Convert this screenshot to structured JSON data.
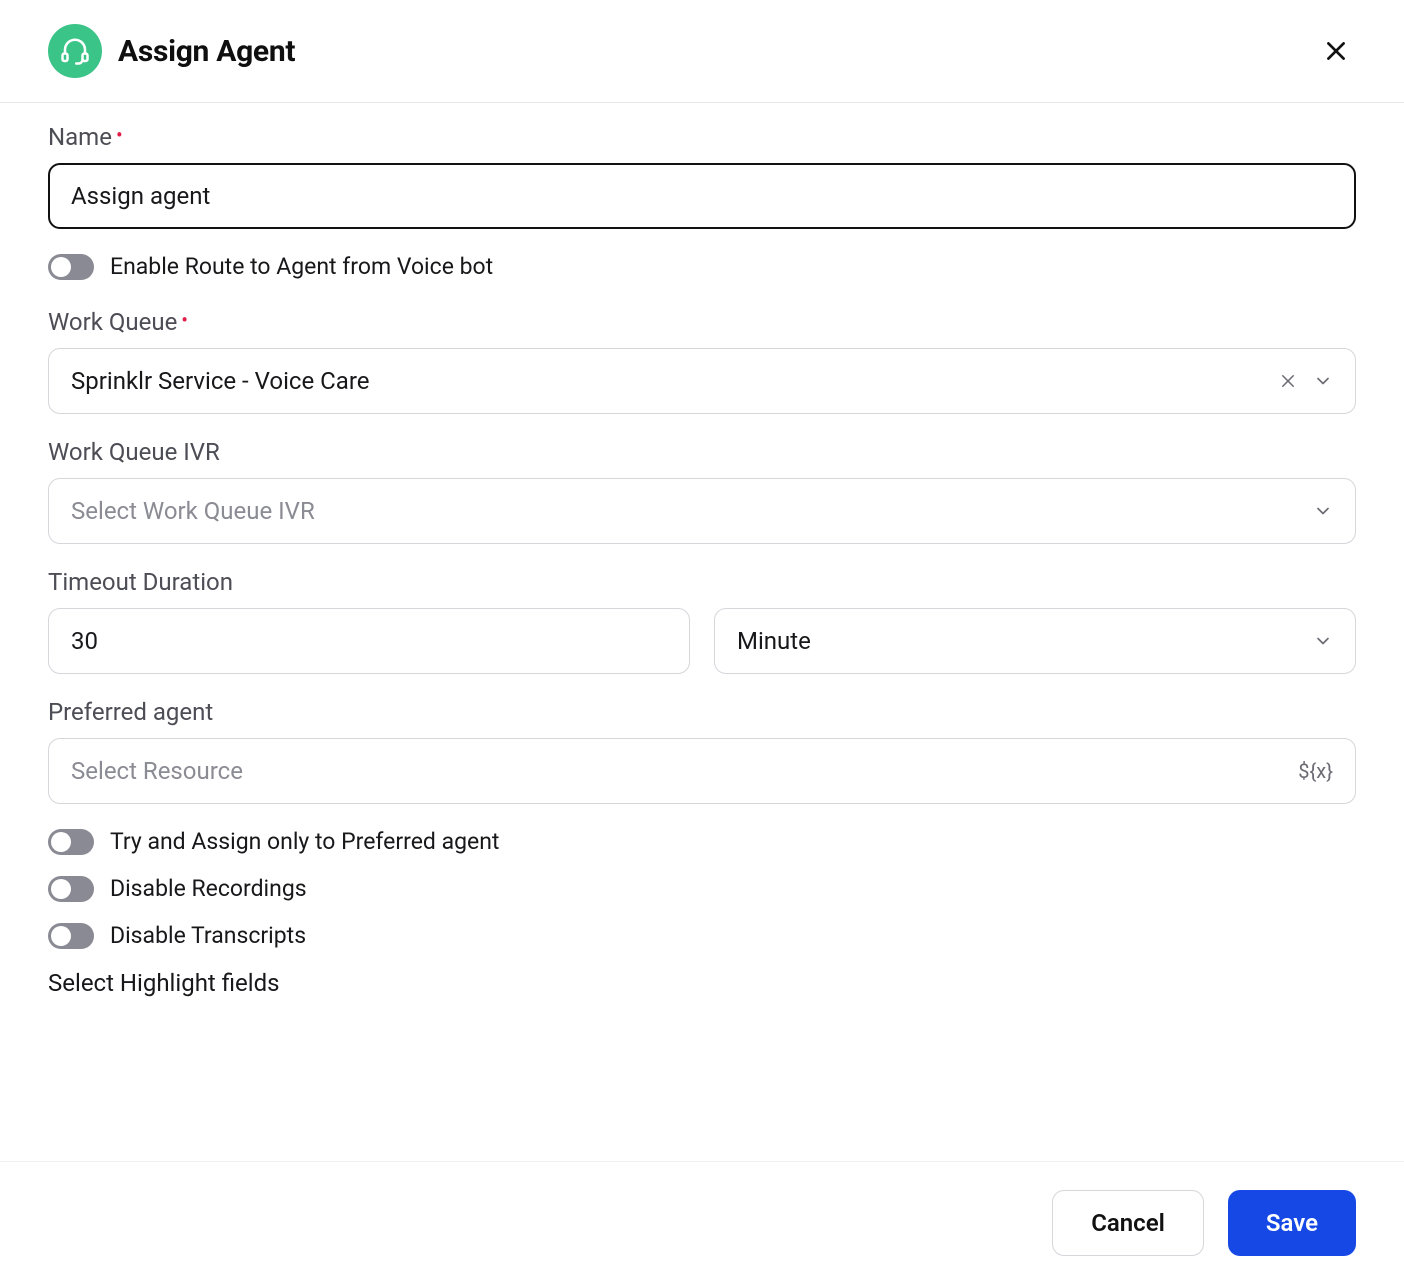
{
  "header": {
    "title": "Assign Agent"
  },
  "fields": {
    "name": {
      "label": "Name",
      "value": "Assign agent"
    },
    "enable_route": {
      "label": "Enable Route to Agent from Voice bot"
    },
    "work_queue": {
      "label": "Work Queue",
      "value": "Sprinklr Service - Voice Care"
    },
    "work_queue_ivr": {
      "label": "Work Queue IVR",
      "placeholder": "Select Work Queue IVR"
    },
    "timeout": {
      "label": "Timeout Duration",
      "value": "30",
      "unit": "Minute"
    },
    "preferred_agent": {
      "label": "Preferred agent",
      "placeholder": "Select Resource",
      "var_hint": "${x}"
    },
    "try_assign_preferred": {
      "label": "Try and Assign only to Preferred agent"
    },
    "disable_recordings": {
      "label": "Disable Recordings"
    },
    "disable_transcripts": {
      "label": "Disable Transcripts"
    },
    "highlight_fields": {
      "label": "Select Highlight fields"
    }
  },
  "footer": {
    "cancel": "Cancel",
    "save": "Save"
  }
}
